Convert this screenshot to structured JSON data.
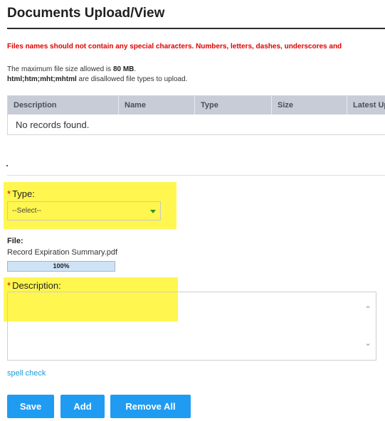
{
  "page": {
    "title": "Documents Upload/View",
    "warning": "Files names should not contain any special characters. Numbers, letters, dashes, underscores and",
    "max_size_prefix": "The maximum file size allowed is ",
    "max_size_value": "80 MB",
    "max_size_suffix": ".",
    "disallowed_types": "html;htm;mht;mhtml",
    "disallowed_suffix": " are disallowed file types to upload."
  },
  "table": {
    "columns": [
      "Description",
      "Name",
      "Type",
      "Size",
      "Latest Up"
    ],
    "empty_message": "No records found."
  },
  "form": {
    "required_marker": "*",
    "type_label": "Type:",
    "type_selected": "--Select--",
    "file_label": "File:",
    "file_name": "Record Expiration Summary.pdf",
    "upload_progress_text": "100%",
    "upload_progress": 1.0,
    "description_label": "Description:",
    "description_value": "",
    "spell_check": "spell check"
  },
  "buttons": {
    "save": "Save",
    "add": "Add",
    "remove_all": "Remove All"
  },
  "icons": {
    "select_arrow": "chevron-down-icon",
    "scroll_up": "chevron-up-icon",
    "scroll_down": "chevron-down-icon"
  },
  "colors": {
    "warning": "#e00000",
    "highlight": "#fff64f",
    "button": "#1f9cf2",
    "link": "#1a9cd8",
    "table_header": "#c7ccd6"
  }
}
